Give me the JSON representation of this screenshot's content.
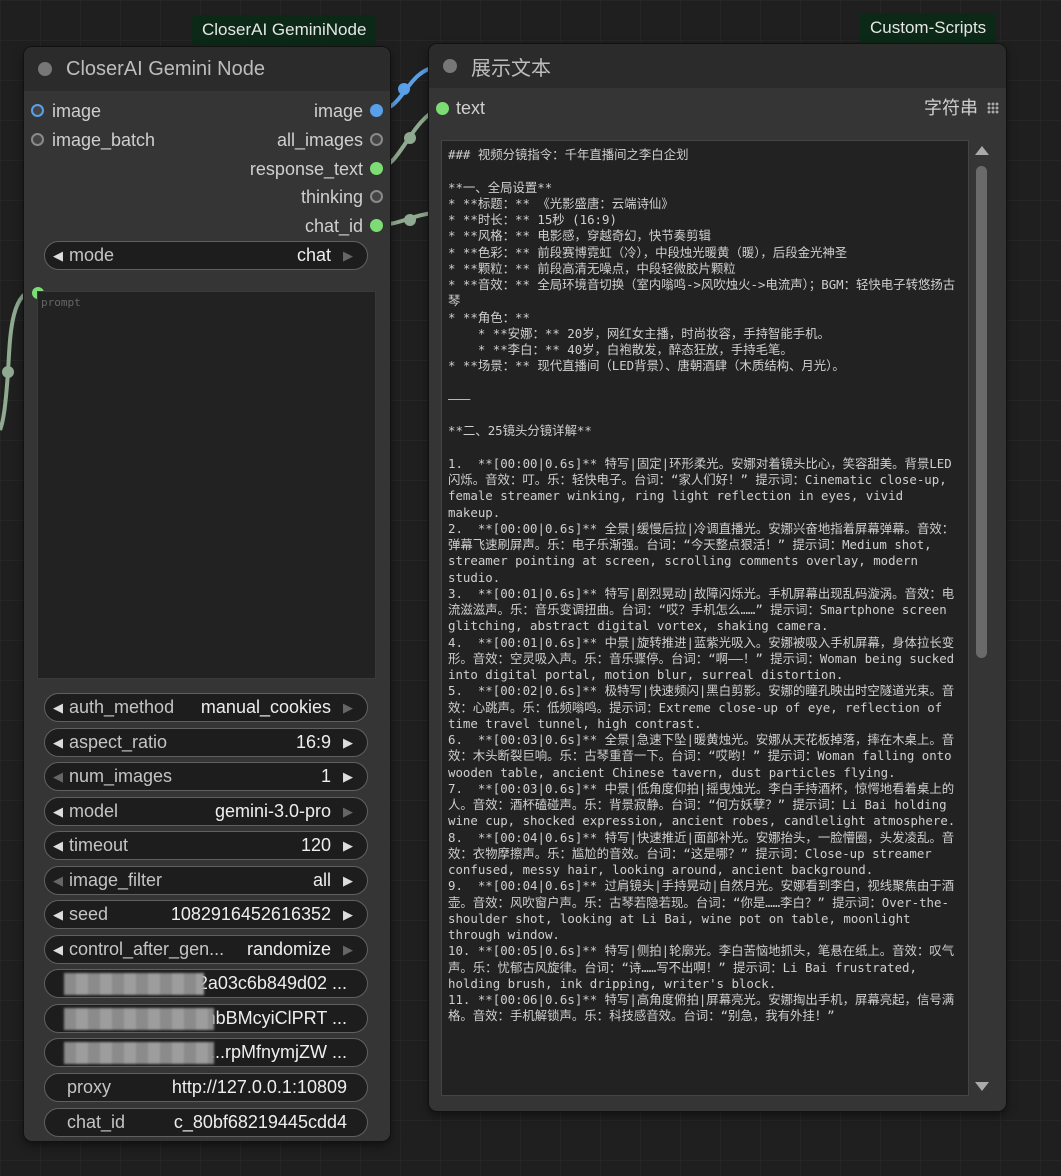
{
  "badges": {
    "left": "CloserAI GeminiNode",
    "right": "Custom-Scripts"
  },
  "gemini_node": {
    "title": "CloserAI Gemini Node",
    "inputs": [
      "image",
      "image_batch"
    ],
    "outputs": [
      "image",
      "all_images",
      "response_text",
      "thinking",
      "chat_id"
    ],
    "mode": {
      "label": "mode",
      "value": "chat"
    },
    "prompt_placeholder": "prompt",
    "widgets": [
      {
        "label": "auth_method",
        "value": "manual_cookies"
      },
      {
        "label": "aspect_ratio",
        "value": "16:9"
      },
      {
        "label": "num_images",
        "value": "1"
      },
      {
        "label": "model",
        "value": "gemini-3.0-pro"
      },
      {
        "label": "timeout",
        "value": "120"
      },
      {
        "label": "image_filter",
        "value": "all"
      },
      {
        "label": "seed",
        "value": "1082916452616352"
      },
      {
        "label": "control_after_gen...",
        "value": "randomize"
      }
    ],
    "hidden_fields": [
      "...2a03c6b849d02 ...",
      "...nbBMcyiClPRT ...",
      "...rpMfnymjZW ..."
    ],
    "proxy": {
      "label": "proxy",
      "value": "http://127.0.0.1:10809"
    },
    "chat_id": {
      "label": "chat_id",
      "value": "c_80bf68219445cdd4"
    }
  },
  "text_node": {
    "title": "展示文本",
    "input_label": "text",
    "type_label": "字符串",
    "content": "### 视频分镜指令：千年直播间之李白企划\n\n**一、全局设置**\n* **标题：** 《光影盛唐：云端诗仙》\n* **时长：** 15秒 (16:9)\n* **风格：** 电影感，穿越奇幻，快节奏剪辑\n* **色彩：** 前段赛博霓虹（冷），中段烛光暖黄（暖），后段金光神圣\n* **颗粒：** 前段高清无噪点，中段轻微胶片颗粒\n* **音效：** 全局环境音切换（室内嗡鸣->风吹烛火->电流声）；BGM：轻快电子转悠扬古琴\n* **角色：**\n    * **安娜：** 20岁，网红女主播，时尚妆容，手持智能手机。\n    * **李白：** 40岁，白袍散发，醉态狂放，手持毛笔。\n* **场景：** 现代直播间（LED背景）、唐朝酒肆（木质结构、月光）。\n\n———\n\n**二、25镜头分镜详解**\n\n1.  **[00:00|0.6s]** 特写|固定|环形柔光。安娜对着镜头比心，笑容甜美。背景LED闪烁。音效：叮。乐：轻快电子。台词：“家人们好！” 提示词：Cinematic close-up, female streamer winking, ring light reflection in eyes, vivid makeup.\n2.  **[00:00|0.6s]** 全景|缓慢后拉|冷调直播光。安娜兴奋地指着屏幕弹幕。音效：弹幕飞速刷屏声。乐：电子乐渐强。台词：“今天整点狠活！” 提示词：Medium shot, streamer pointing at screen, scrolling comments overlay, modern studio.\n3.  **[00:01|0.6s]** 特写|剧烈晃动|故障闪烁光。手机屏幕出现乱码漩涡。音效：电流滋滋声。乐：音乐变调扭曲。台词：“哎？手机怎么……” 提示词：Smartphone screen glitching, abstract digital vortex, shaking camera.\n4.  **[00:01|0.6s]** 中景|旋转推进|蓝紫光吸入。安娜被吸入手机屏幕，身体拉长变形。音效：空灵吸入声。乐：音乐骤停。台词：“啊——！” 提示词：Woman being sucked into digital portal, motion blur, surreal distortion.\n5.  **[00:02|0.6s]** 极特写|快速频闪|黑白剪影。安娜的瞳孔映出时空隧道光束。音效：心跳声。乐：低频嗡鸣。提示词：Extreme close-up of eye, reflection of time travel tunnel, high contrast.\n6.  **[00:03|0.6s]** 全景|急速下坠|暖黄烛光。安娜从天花板掉落，摔在木桌上。音效：木头断裂巨响。乐：古琴重音一下。台词：“哎哟！” 提示词：Woman falling onto wooden table, ancient Chinese tavern, dust particles flying.\n7.  **[00:03|0.6s]** 中景|低角度仰拍|摇曳烛光。李白手持酒杯，惊愕地看着桌上的人。音效：酒杯磕碰声。乐：背景寂静。台词：“何方妖孽？” 提示词：Li Bai holding wine cup, shocked expression, ancient robes, candlelight atmosphere.\n8.  **[00:04|0.6s]** 特写|快速推近|面部补光。安娜抬头，一脸懵圈，头发凌乱。音效：衣物摩擦声。乐：尴尬的音效。台词：“这是哪？” 提示词：Close-up streamer confused, messy hair, looking around, ancient background.\n9.  **[00:04|0.6s]** 过肩镜头|手持晃动|自然月光。安娜看到李白，视线聚焦由于酒壶。音效：风吹窗户声。乐：古琴若隐若现。台词：“你是……李白？” 提示词：Over-the-shoulder shot, looking at Li Bai, wine pot on table, moonlight through window.\n10. **[00:05|0.6s]** 特写|侧拍|轮廓光。李白苦恼地抓头，笔悬在纸上。音效：叹气声。乐：忧郁古风旋律。台词：“诗……写不出啊！” 提示词：Li Bai frustrated, holding brush, ink dripping, writer's block.\n11. **[00:06|0.6s]** 特写|高角度俯拍|屏幕亮光。安娜掏出手机，屏幕亮起，信号满格。音效：手机解锁声。乐：科技感音效。台词：“别急，我有外挂！”"
  }
}
